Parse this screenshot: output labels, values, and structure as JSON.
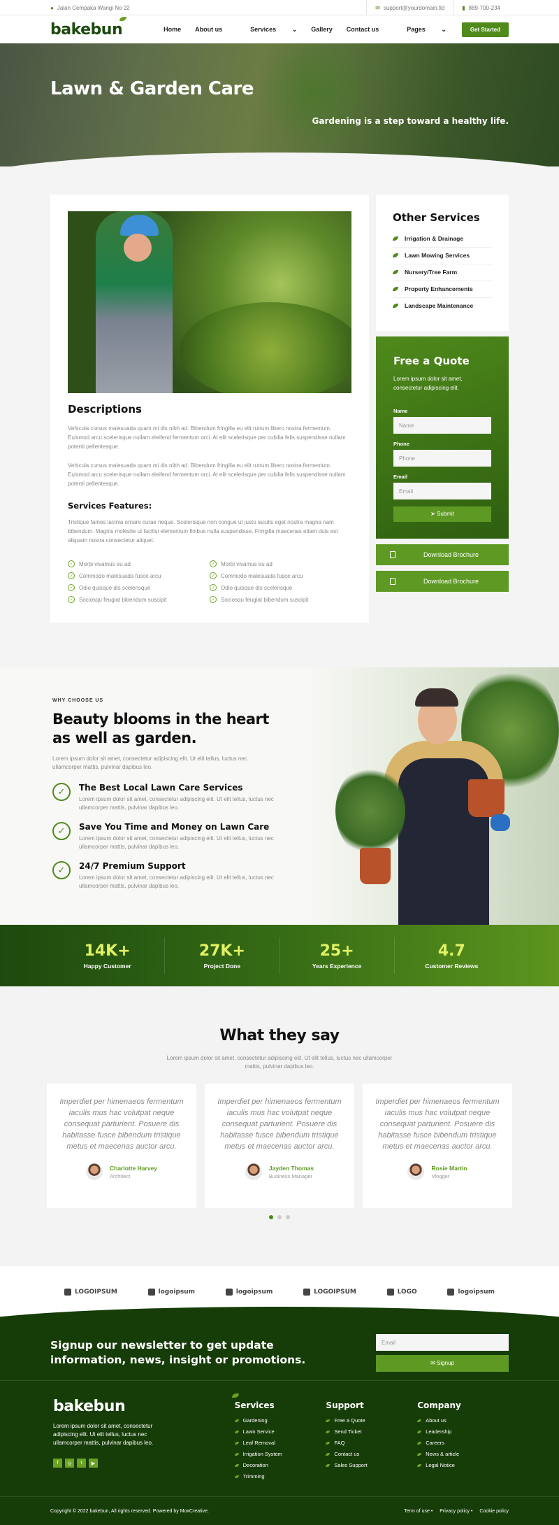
{
  "topbar": {
    "address": "Jalan Cempaka Wangi No 22",
    "email": "support@yourdomain.tld",
    "phone": "889-700-234"
  },
  "nav": {
    "logo": "bakebun",
    "items": [
      "Home",
      "About us",
      "Services",
      "Gallery",
      "Contact us",
      "Pages"
    ],
    "cta": "Get Started"
  },
  "hero": {
    "title": "Lawn & Garden Care",
    "tagline": "Gardening is a step toward a healthy life."
  },
  "service": {
    "desc_title": "Descriptions",
    "desc_p1": "Vehicula cursus malesuada quam mi dis nibh ad. Bibendum fringilla eu elit rutrum libero nostra fermentum. Euismod arcu scelerisque nullam eleifend fermentum orci. At elit scelerisque per cubilia felis suspendisse nullam potenti pellentesque.",
    "desc_p2": "Vehicula cursus malesuada quam mi dis nibh ad. Bibendum fringilla eu elit rutrum libero nostra fermentum. Euismod arcu scelerisque nullam eleifend fermentum orci. At elit scelerisque per cubilia felis suspendisse nullam potenti pellentesque.",
    "features_title": "Services Features:",
    "features_p": "Tristique fames lacinia ornare curae neque. Scelerisque non congue ut justo iaculis eget nostra magna nam bibendum. Magnis molestie ut facilisi elementum finibus nulla suspendisse. Fringilla maecenas etiam duis est aliquam nostra consectetur aliquet.",
    "features": [
      "Morbi vivamus eu ad",
      "Morbi vivamus eu ad",
      "Commodo malesuada fusce arcu",
      "Commodo malesuada fusce arcu",
      "Odio quisque dis scelerisque",
      "Odio quisque dis scelerisque",
      "Sociosqu feugiat bibendum suscipit",
      "Sociosqu feugiat bibendum suscipit"
    ]
  },
  "other_services": {
    "title": "Other Services",
    "items": [
      "Irrigation & Drainage",
      "Lawn Mowing Services",
      "Nursery/Tree Farm",
      "Property Enhancements",
      "Landscape Maintenance"
    ]
  },
  "quote": {
    "title": "Free a Quote",
    "text": "Lorem ipsum dolor sit amet, consectetur adipiscing elit.",
    "name_label": "Name",
    "name_ph": "Name",
    "phone_label": "Phone",
    "phone_ph": "Phone",
    "email_label": "Email",
    "email_ph": "Email",
    "submit": "Submit"
  },
  "downloads": [
    "Download Brochure",
    "Download Brochure"
  ],
  "why": {
    "eyebrow": "WHY CHOOSE US",
    "title": "Beauty blooms in the heart as well as garden.",
    "intro": "Lorem ipsum dolor sit amet, consectetur adipiscing elit. Ut elit tellus, luctus nec ullamcorper mattis, pulvinar dapibus leo.",
    "items": [
      {
        "title": "The Best Local Lawn Care Services",
        "text": "Lorem ipsum dolor sit amet, consectetur adipiscing elit. Ut elit tellus, luctus nec ullamcorper mattis, pulvinar dapibus leo."
      },
      {
        "title": "Save You Time and Money on Lawn Care",
        "text": "Lorem ipsum dolor sit amet, consectetur adipiscing elit. Ut elit tellus, luctus nec ullamcorper mattis, pulvinar dapibus leo."
      },
      {
        "title": "24/7 Premium Support",
        "text": "Lorem ipsum dolor sit amet, consectetur adipiscing elit. Ut elit tellus, luctus nec ullamcorper mattis, pulvinar dapibus leo."
      }
    ]
  },
  "stats": [
    {
      "n": "14K+",
      "l": "Happy Customer"
    },
    {
      "n": "27K+",
      "l": "Project Done"
    },
    {
      "n": "25+",
      "l": "Years Experience"
    },
    {
      "n": "4.7",
      "l": "Customer Reviews"
    }
  ],
  "testimonials": {
    "title": "What they say",
    "sub": "Lorem ipsum dolor sit amet, consectetur adipiscing elit. Ut elit tellus, luctus nec ullamcorper mattis, pulvinar dapibus leo.",
    "items": [
      {
        "q": "Imperdiet per himenaeos fermentum iaculis mus hac volutpat neque consequat parturient. Posuere dis habitasse fusce bibendum tristique metus et maecenas auctor arcu.",
        "name": "Charlotte Harvey",
        "role": "Architect"
      },
      {
        "q": "Imperdiet per himenaeos fermentum iaculis mus hac volutpat neque consequat parturient. Posuere dis habitasse fusce bibendum tristique metus et maecenas auctor arcu.",
        "name": "Jayden Thomas",
        "role": "Business Manager"
      },
      {
        "q": "Imperdiet per himenaeos fermentum iaculis mus hac volutpat neque consequat parturient. Posuere dis habitasse fusce bibendum tristique metus et maecenas auctor arcu.",
        "name": "Rosie Martin",
        "role": "Vlogger"
      }
    ]
  },
  "logos": [
    "LOGOIPSUM",
    "logoipsum",
    "logoipsum",
    "LOGOIPSUM",
    "LOGO",
    "logoipsum"
  ],
  "newsletter": {
    "title": "Signup our newsletter to get update information, news, insight or promotions.",
    "email_ph": "Email",
    "button": "Signup"
  },
  "footer": {
    "logo": "bakebun",
    "about": "Lorem ipsum dolor sit amet, consectetur adipiscing elit. Ut elit tellus, luctus nec ullamcorper mattis, pulvinar dapibus leo.",
    "services_title": "Services",
    "services": [
      "Gardening",
      "Lawn Service",
      "Leaf Removal",
      "Irrigation System",
      "Decoration",
      "Trimming"
    ],
    "support_title": "Support",
    "support": [
      "Free a Quote",
      "Send Ticket",
      "FAQ",
      "Contact us",
      "Sales Support"
    ],
    "company_title": "Company",
    "company": [
      "About us",
      "Leadership",
      "Careers",
      "News & article",
      "Legal Notice"
    ],
    "copyright": "Copyright © 2022 bakebun, All rights reserved. Powered by MoxCreative.",
    "links": [
      "Term of use",
      "Privacy policy",
      "Cookie policy"
    ]
  },
  "colors": {
    "primary": "#4f8a1b",
    "dark": "#163c08",
    "accent": "#e2f263"
  }
}
